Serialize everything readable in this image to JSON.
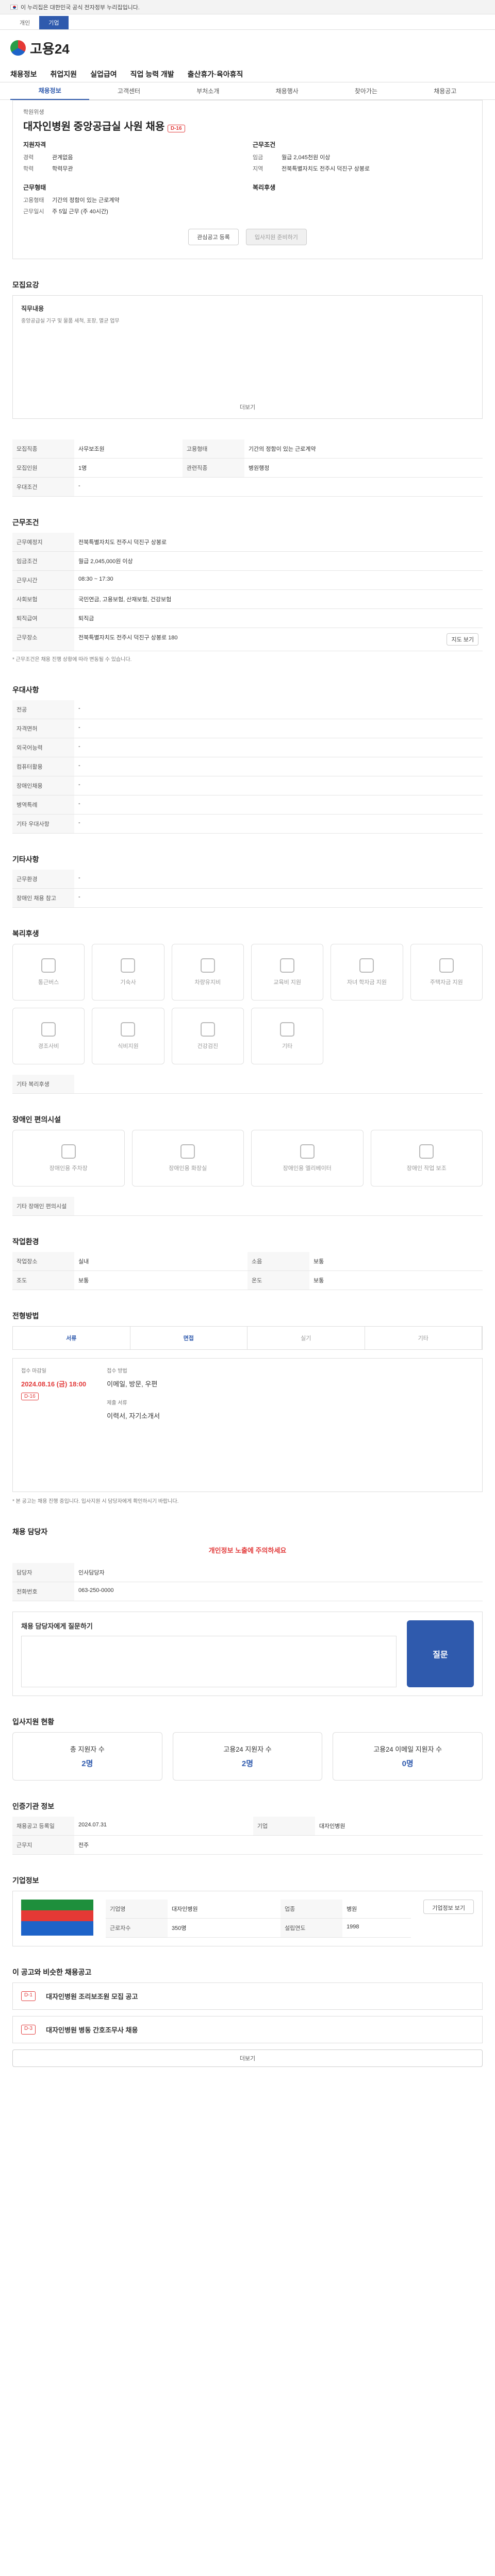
{
  "gov_banner": {
    "text": "이 누리집은 대한민국 공식 전자정부 누리집입니다.",
    "tabs": [
      "개인",
      "기업"
    ]
  },
  "logo": "고용24",
  "gnb": [
    "채용정보",
    "취업지원",
    "실업급여",
    "직업 능력 개발",
    "출산휴가·육아휴직"
  ],
  "lnb": [
    "채용정보",
    "고객센터",
    "부처소개",
    "채용행사",
    "찾아가는",
    "채용공고"
  ],
  "job": {
    "company_label": "학원위생",
    "title": "대자인병원 중앙공급실 사원 채용",
    "dday": "D-16",
    "left_head": "지원자격",
    "left": [
      [
        "경력",
        "관계없음"
      ],
      [
        "학력",
        "학력무관"
      ]
    ],
    "right_head": "근무조건",
    "right": [
      [
        "임금",
        "월급 2,045천원 이상"
      ],
      [
        "지역",
        "전북특별자치도 전주시 덕진구 상봉로"
      ]
    ],
    "extra_head": "근무형태",
    "extra": [
      [
        "고용형태",
        "기간의 정함이 있는 근로계약"
      ],
      [
        "근무일시",
        "주 5일 근무 (주 40시간)"
      ]
    ],
    "extra_right_head": "복리후생",
    "btn_interest": "관심공고 등록",
    "btn_apply": "입사지원 준비하기"
  },
  "duty": {
    "title": "모집요강",
    "head": "직무내용",
    "body": "중앙공급실 기구 및 물품 세척, 포장, 멸균 업무",
    "more": "더보기"
  },
  "recruit": {
    "rows": [
      [
        "모집직종",
        "사무보조원"
      ],
      [
        "고용형태",
        "기간의 정함이 있는 근로계약"
      ],
      [
        "모집인원",
        "1명"
      ],
      [
        "관련직종",
        "병원행정"
      ],
      [
        "우대조건",
        "-"
      ]
    ]
  },
  "work": {
    "title": "근무조건",
    "rows": [
      [
        "근무예정지",
        "전북특별자치도 전주시 덕진구 상봉로"
      ],
      [
        "임금조건",
        "월급 2,045,000원 이상"
      ],
      [
        "근무시간",
        "08:30 ~ 17:30"
      ],
      [
        "사회보험",
        "국민연금, 고용보험, 산재보험, 건강보험"
      ],
      [
        "퇴직급여",
        "퇴직금"
      ],
      [
        "근무장소",
        "전북특별자치도 전주시 덕진구 상봉로 180"
      ]
    ],
    "map_btn": "지도 보기",
    "note": "* 근무조건은 채용 진행 상황에 따라 변동될 수 있습니다."
  },
  "pref": {
    "title": "우대사항",
    "rows": [
      [
        "전공",
        "-"
      ],
      [
        "자격면허",
        "-"
      ],
      [
        "외국어능력",
        "-"
      ],
      [
        "컴퓨터활용",
        "-"
      ],
      [
        "장애인채용",
        "-"
      ],
      [
        "병역특례",
        "-"
      ],
      [
        "기타 우대사항",
        "-"
      ]
    ]
  },
  "other": {
    "title": "기타사항",
    "rows": [
      [
        "근무환경",
        "-"
      ],
      [
        "장애인 채용 참고",
        "-"
      ]
    ]
  },
  "welfare": {
    "title": "복리후생",
    "cards": [
      "통근버스",
      "기숙사",
      "차량유지비",
      "교육비 지원",
      "자녀 학자금 지원",
      "주택자금 지원",
      "경조사비",
      "식비지원",
      "건강검진",
      "기타"
    ],
    "note_label": "기타 복리후생"
  },
  "disab": {
    "title": "장애인 편의시설",
    "cards": [
      "장애인용 주차장",
      "장애인용 화장실",
      "장애인용 엘리베이터",
      "장애인 작업 보조"
    ],
    "note_label": "기타 장애인 편의시설"
  },
  "env": {
    "title": "작업환경",
    "rows": [
      [
        "작업장소",
        "실내"
      ],
      [
        "소음",
        "보통"
      ],
      [
        "조도",
        "보통"
      ],
      [
        "온도",
        "보통"
      ]
    ]
  },
  "process": {
    "title": "전형방법",
    "steps": [
      "서류",
      "면접",
      "실기",
      "기타"
    ],
    "deadline_label": "접수 마감일",
    "deadline": "2024.08.16 (금) 18:00",
    "dday": "D-16",
    "method_label": "접수 방법",
    "method": "이메일, 방문, 우편",
    "docs_label": "제출 서류",
    "docs": "이력서, 자기소개서",
    "note": "* 본 공고는 채용 진행 중입니다. 입사지원 시 담당자에게 확인하시기 바랍니다."
  },
  "contact": {
    "title": "채용 담당자",
    "warn": "개인정보 노출에 주의하세요",
    "name_label": "담당자",
    "name": "인사담당자",
    "phone_label": "전화번호",
    "phone": "063-250-0000",
    "question_title": "채용 담당자에게 질문하기",
    "question_btn": "질문"
  },
  "stats": {
    "title": "입사지원 현황",
    "items": [
      [
        "총 지원자 수",
        "2명"
      ],
      [
        "고용24 지원자 수",
        "2명"
      ],
      [
        "고용24 이메일 지원자 수",
        "0명"
      ]
    ]
  },
  "info": {
    "title": "인증기관 정보",
    "rows": [
      [
        "채용공고 등록일",
        "2024.07.31"
      ],
      [
        "기업",
        "대자인병원"
      ],
      [
        "근무지",
        "전주"
      ]
    ],
    "btn": "기업정보 보기"
  },
  "company": {
    "title": "기업정보",
    "rows": [
      [
        "기업명",
        "대자인병원"
      ],
      [
        "업종",
        "병원"
      ],
      [
        "근로자수",
        "350명"
      ],
      [
        "설립연도",
        "1998"
      ]
    ]
  },
  "similar": {
    "title": "이 공고와 비슷한 채용공고",
    "items": [
      [
        "D-1",
        "대자인병원 조리보조원 모집 공고"
      ],
      [
        "D-3",
        "대자인병원 병동 간호조무사 채용"
      ]
    ],
    "more": "더보기"
  }
}
